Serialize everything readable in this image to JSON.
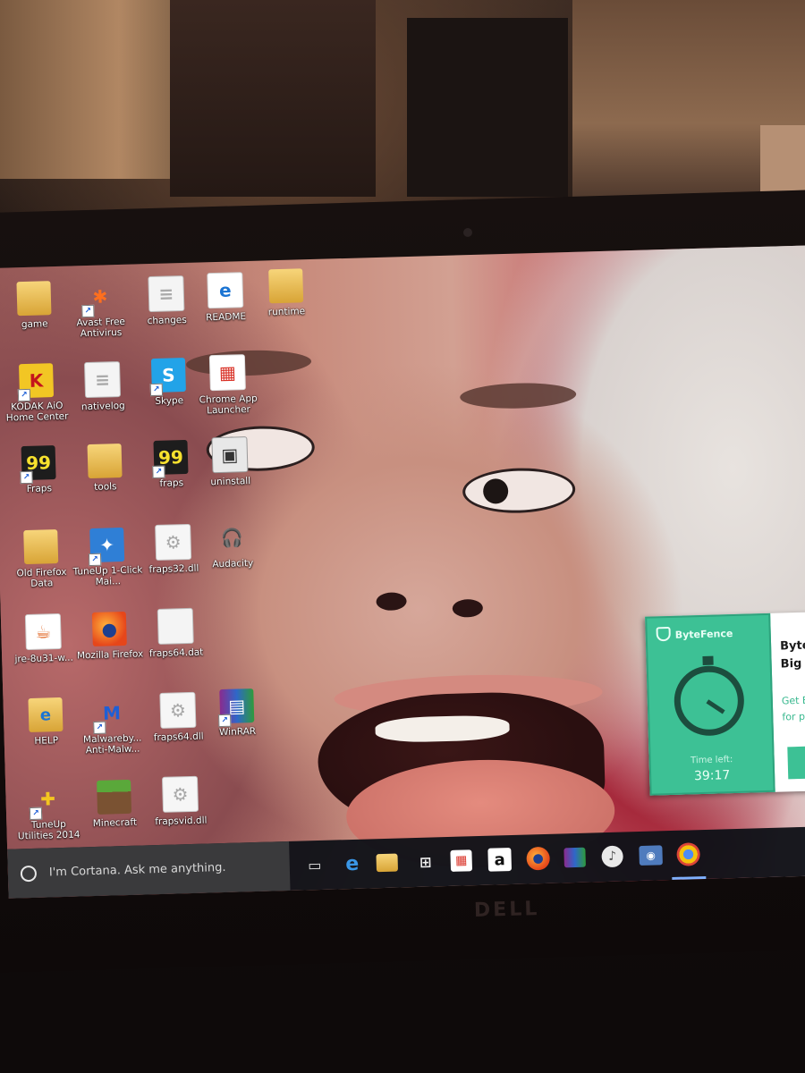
{
  "desktop": {
    "icons": [
      {
        "label": "game",
        "icon": "folder-icon"
      },
      {
        "label": "Avast Free Antivirus",
        "icon": "avast-icon"
      },
      {
        "label": "changes",
        "icon": "document-icon"
      },
      {
        "label": "README",
        "icon": "internet-explorer-file-icon"
      },
      {
        "label": "runtime",
        "icon": "folder-icon"
      },
      {
        "label": "KODAK AiO Home Center",
        "icon": "kodak-icon"
      },
      {
        "label": "nativelog",
        "icon": "document-icon"
      },
      {
        "label": "Skype",
        "icon": "skype-icon"
      },
      {
        "label": "Chrome App Launcher",
        "icon": "chrome-app-launcher-icon"
      },
      {
        "label": "Fraps",
        "icon": "fraps-icon"
      },
      {
        "label": "tools",
        "icon": "folder-icon"
      },
      {
        "label": "fraps",
        "icon": "fraps-icon"
      },
      {
        "label": "uninstall",
        "icon": "uninstall-icon"
      },
      {
        "label": "Old Firefox Data",
        "icon": "folder-icon"
      },
      {
        "label": "TuneUp 1-Click Mai...",
        "icon": "tuneup-icon"
      },
      {
        "label": "fraps32.dll",
        "icon": "dll-file-icon"
      },
      {
        "label": "Audacity",
        "icon": "audacity-icon"
      },
      {
        "label": "jre-8u31-w...",
        "icon": "java-installer-icon"
      },
      {
        "label": "Mozilla Firefox",
        "icon": "firefox-icon"
      },
      {
        "label": "fraps64.dat",
        "icon": "blank-file-icon"
      },
      {
        "label": "HELP",
        "icon": "help-file-icon"
      },
      {
        "label": "Malwareby... Anti-Malw...",
        "icon": "malwarebytes-icon"
      },
      {
        "label": "fraps64.dll",
        "icon": "dll-file-icon"
      },
      {
        "label": "WinRAR",
        "icon": "winrar-icon"
      },
      {
        "label": "TuneUp Utilities 2014",
        "icon": "tuneup-utilities-icon"
      },
      {
        "label": "Minecraft",
        "icon": "minecraft-icon"
      },
      {
        "label": "frapsvid.dll",
        "icon": "dll-file-icon"
      }
    ]
  },
  "bytefence": {
    "brand": "ByteFence",
    "time_label": "Time left:",
    "time_value": "39:17",
    "title_partial": "ByteF\nBig S",
    "link_partial": "Get B\nfor p",
    "accent_color": "#3dc195"
  },
  "taskbar": {
    "search_placeholder": "I'm Cortana. Ask me anything.",
    "apps": [
      "task-view-icon",
      "edge-icon",
      "file-explorer-icon",
      "store-icon",
      "chrome-app-launcher-icon",
      "amazon-icon",
      "firefox-icon",
      "winrar-icon",
      "itunes-icon",
      "webcam-icon",
      "chrome-icon"
    ],
    "active_app": "chrome-icon"
  },
  "bezel": {
    "brand": "DELL"
  }
}
